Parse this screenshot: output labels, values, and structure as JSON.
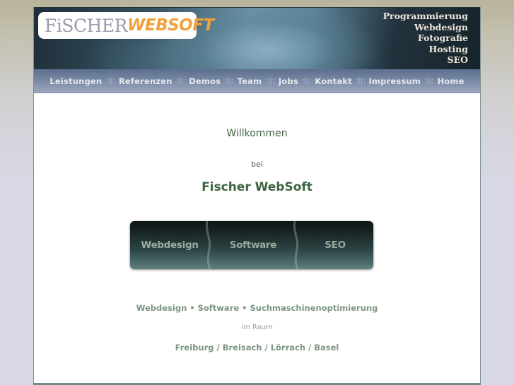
{
  "header": {
    "logo": {
      "part1": "FiSCHER",
      "part2": "WEBSOFT"
    },
    "services": [
      "Programmierung",
      "Webdesign",
      "Fotografie",
      "Hosting",
      "SEO"
    ]
  },
  "nav": {
    "separator": ":||:",
    "items": [
      {
        "label": "Leistungen"
      },
      {
        "label": "Referenzen"
      },
      {
        "label": "Demos"
      },
      {
        "label": "Team"
      },
      {
        "label": "Jobs"
      },
      {
        "label": "Kontakt"
      },
      {
        "label": "Impressum"
      },
      {
        "label": "Home"
      }
    ]
  },
  "content": {
    "welcome": "Willkommen",
    "bei": "bei",
    "company": "Fischer WebSoft",
    "banner": [
      "Webdesign",
      "Software",
      "SEO"
    ],
    "tagline": "Webdesign • Software • Suchmaschinenoptimierung",
    "raum": "im Raum",
    "cities": "Freiburg / Breisach / Lörrach / Basel"
  },
  "colors": {
    "logo_grey": "#9a9cad",
    "logo_orange": "#f2a13a",
    "heading_green": "#3d6440",
    "subtext_green": "#7d9580",
    "nav_text": "#e6e8ee"
  }
}
